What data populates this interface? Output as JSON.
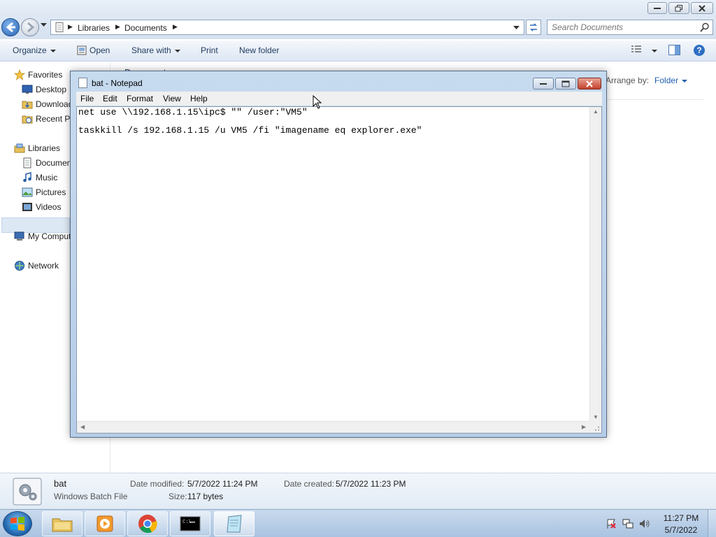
{
  "explorer": {
    "breadcrumb": [
      "Libraries",
      "Documents"
    ],
    "search": {
      "placeholder": "Search Documents"
    },
    "toolbar": {
      "organize": "Organize",
      "open": "Open",
      "share_with": "Share with",
      "print": "Print",
      "new_folder": "New folder"
    },
    "nav": {
      "favorites": "Favorites",
      "desktop": "Desktop",
      "downloads": "Downloads",
      "recent": "Recent Places",
      "libraries": "Libraries",
      "documents": "Documents",
      "music": "Music",
      "pictures": "Pictures",
      "videos": "Videos",
      "computer": "My Computer",
      "network": "Network"
    },
    "arrange_by": {
      "label": "Arrange by:",
      "value": "Folder"
    },
    "details": {
      "filename": "bat",
      "filetype": "Windows Batch File",
      "date_modified_label": "Date modified:",
      "date_modified": "5/7/2022 11:24 PM",
      "date_created_label": "Date created:",
      "date_created": "5/7/2022 11:23 PM",
      "size_label": "Size:",
      "size": "117 bytes"
    }
  },
  "notepad": {
    "title": "bat - Notepad",
    "menu": [
      "File",
      "Edit",
      "Format",
      "View",
      "Help"
    ],
    "lines": [
      "net use \\\\192.168.1.15\\ipc$ \"\" /user:\"VM5\"",
      "taskkill /s 192.168.1.15 /u VM5 /fi \"imagename eq explorer.exe\""
    ]
  },
  "taskbar": {
    "time": "11:27 PM",
    "date": "5/7/2022",
    "apps": [
      "explorer-icon",
      "media-player-icon",
      "chrome-icon",
      "cmd-icon",
      "notepad-icon"
    ]
  },
  "colors": {
    "accent": "#1f5fb0",
    "title_gradient_top": "#c7dbef",
    "close_button": "#c4402c",
    "taskbar": "#a9c3e0"
  }
}
